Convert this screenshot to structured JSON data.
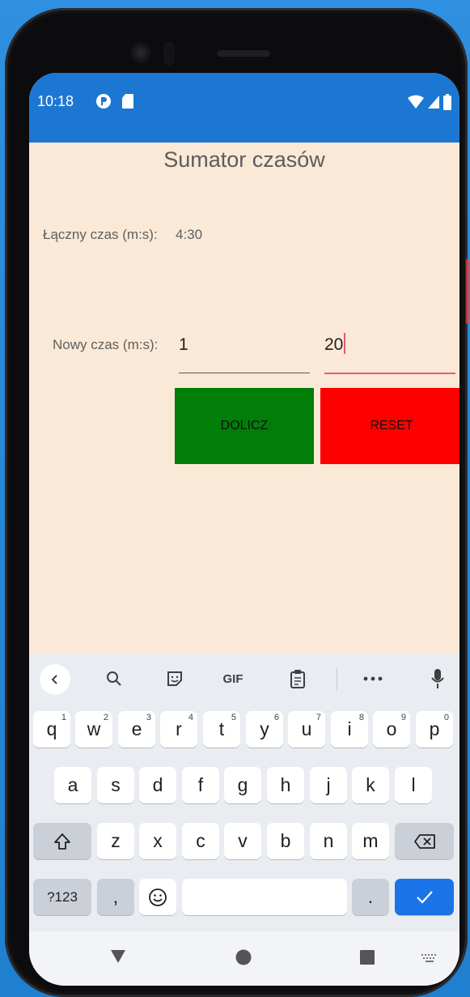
{
  "status": {
    "time": "10:18"
  },
  "app": {
    "title": "Sumator czasów",
    "total_label": "Łączny czas (m:s):",
    "total_value": "4:30",
    "new_label": "Nowy czas (m:s):",
    "minutes_value": "1",
    "seconds_value": "20",
    "add_button": "DOLICZ",
    "reset_button": "RESET"
  },
  "colors": {
    "statusbar": "#1c77d3",
    "background": "#fae9d6",
    "add_button": "#007e07",
    "reset_button": "#ff0000",
    "accent": "#e35a7b"
  },
  "keyboard": {
    "toolbar": {
      "gif": "GIF"
    },
    "row1": [
      {
        "k": "q",
        "h": "1"
      },
      {
        "k": "w",
        "h": "2"
      },
      {
        "k": "e",
        "h": "3"
      },
      {
        "k": "r",
        "h": "4"
      },
      {
        "k": "t",
        "h": "5"
      },
      {
        "k": "y",
        "h": "6"
      },
      {
        "k": "u",
        "h": "7"
      },
      {
        "k": "i",
        "h": "8"
      },
      {
        "k": "o",
        "h": "9"
      },
      {
        "k": "p",
        "h": "0"
      }
    ],
    "row2": [
      "a",
      "s",
      "d",
      "f",
      "g",
      "h",
      "j",
      "k",
      "l"
    ],
    "row3": [
      "z",
      "x",
      "c",
      "v",
      "b",
      "n",
      "m"
    ],
    "sym": "?123",
    "comma": ",",
    "period": "."
  }
}
